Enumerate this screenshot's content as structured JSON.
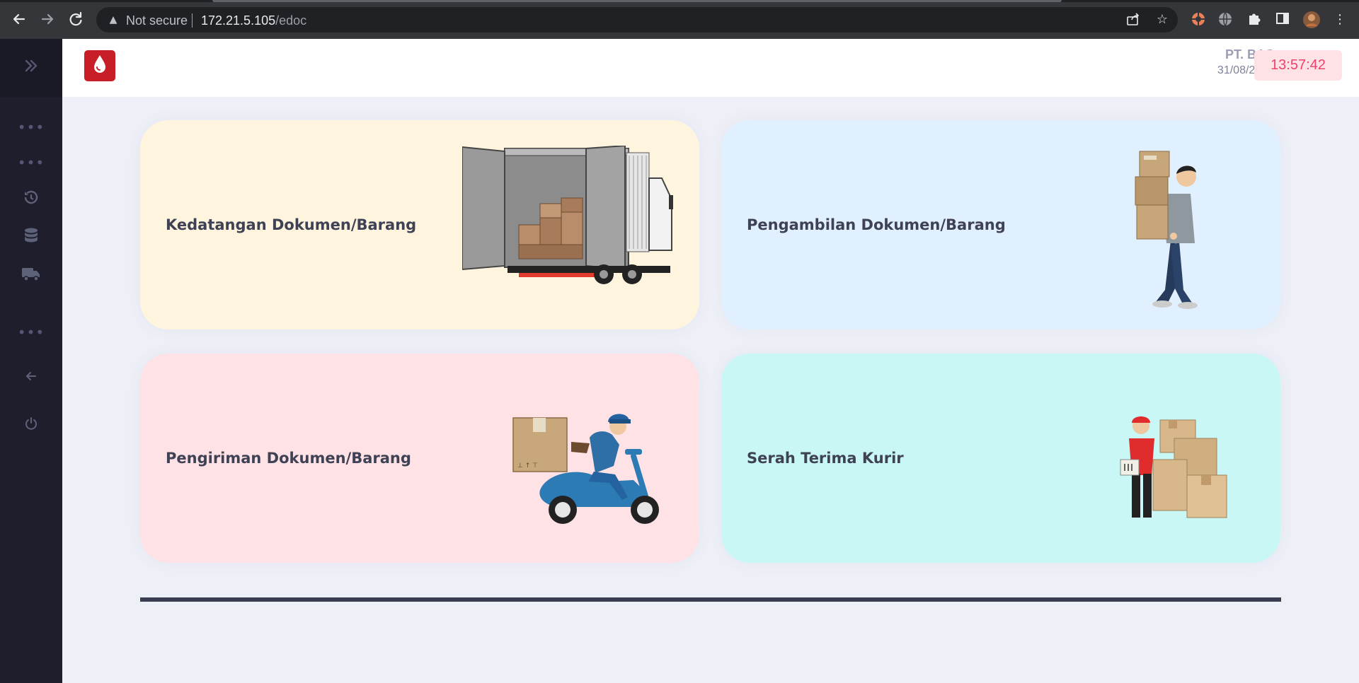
{
  "browser": {
    "security_label": "Not secure",
    "url_host": "172.21.5.105",
    "url_path": "/edoc",
    "icons": [
      "back-icon",
      "forward-icon",
      "reload-icon",
      "warning-icon",
      "share-icon",
      "bookmark-star-icon",
      "extension-icon",
      "globe-icon",
      "puzzle-icon",
      "side-panel-icon",
      "profile-avatar",
      "menu-kebab-icon"
    ]
  },
  "sidebar": {
    "items": [
      {
        "icon": "toggle-chevrons-icon"
      },
      {
        "icon": "more-dots-icon"
      },
      {
        "icon": "more-dots-icon"
      },
      {
        "icon": "history-icon"
      },
      {
        "icon": "database-icon"
      },
      {
        "icon": "truck-icon"
      },
      {
        "icon": "more-dots-icon"
      },
      {
        "icon": "arrow-left-icon"
      },
      {
        "icon": "power-icon"
      }
    ]
  },
  "header": {
    "company": "PT. BAS",
    "date": "31/08/2023",
    "time": "13:57:42"
  },
  "cards": [
    {
      "title": "Kedatangan Dokumen/Barang",
      "illustration": "open-delivery-truck",
      "color": "#fff4de"
    },
    {
      "title": "Pengambilan Dokumen/Barang",
      "illustration": "man-carrying-boxes",
      "color": "#e1f0ff"
    },
    {
      "title": "Pengiriman Dokumen/Barang",
      "illustration": "courier-on-scooter",
      "color": "#ffe2e5"
    },
    {
      "title": "Serah Terima Kurir",
      "illustration": "courier-with-parcels",
      "color": "#c9f7f5"
    }
  ],
  "colors": {
    "clock_text": "#f1416c",
    "clock_bg": "#ffe2e5",
    "sidebar_bg": "#1e1e2d",
    "brand_red": "#c81e28"
  }
}
